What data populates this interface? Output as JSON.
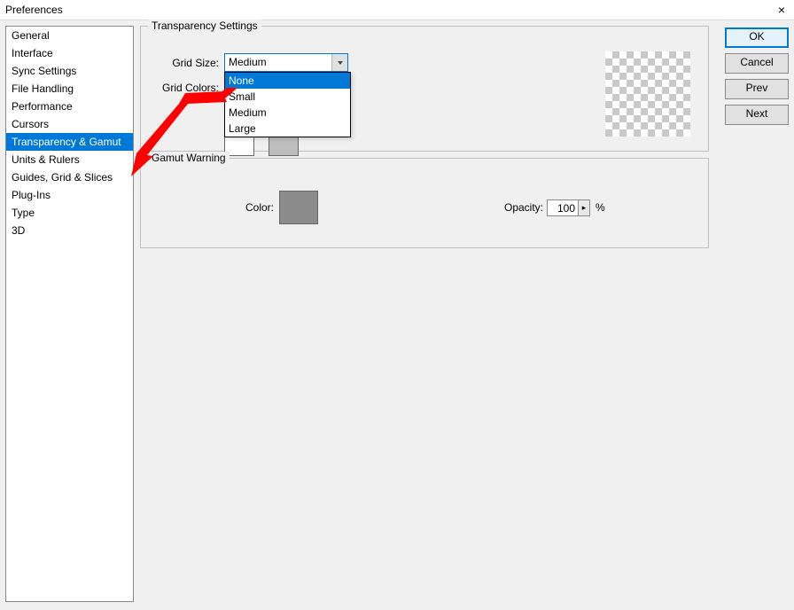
{
  "window": {
    "title": "Preferences"
  },
  "sidebar": {
    "items": [
      "General",
      "Interface",
      "Sync Settings",
      "File Handling",
      "Performance",
      "Cursors",
      "Transparency & Gamut",
      "Units & Rulers",
      "Guides, Grid & Slices",
      "Plug-Ins",
      "Type",
      "3D"
    ],
    "selected_index": 6
  },
  "buttons": {
    "ok": "OK",
    "cancel": "Cancel",
    "prev": "Prev",
    "next": "Next"
  },
  "transparency": {
    "legend": "Transparency Settings",
    "grid_size_label": "Grid Size:",
    "grid_size_value": "Medium",
    "grid_size_options": {
      "none": "None",
      "small": "Small",
      "medium": "Medium",
      "large": "Large"
    },
    "grid_size_highlighted_option": "None",
    "grid_colors_label": "Grid Colors:"
  },
  "gamut": {
    "legend": "Gamut Warning",
    "color_label": "Color:",
    "opacity_label": "Opacity:",
    "opacity_value": "100",
    "percent": "%"
  },
  "icons": {
    "close": "×",
    "chevron": "v",
    "stepper": "▸"
  }
}
